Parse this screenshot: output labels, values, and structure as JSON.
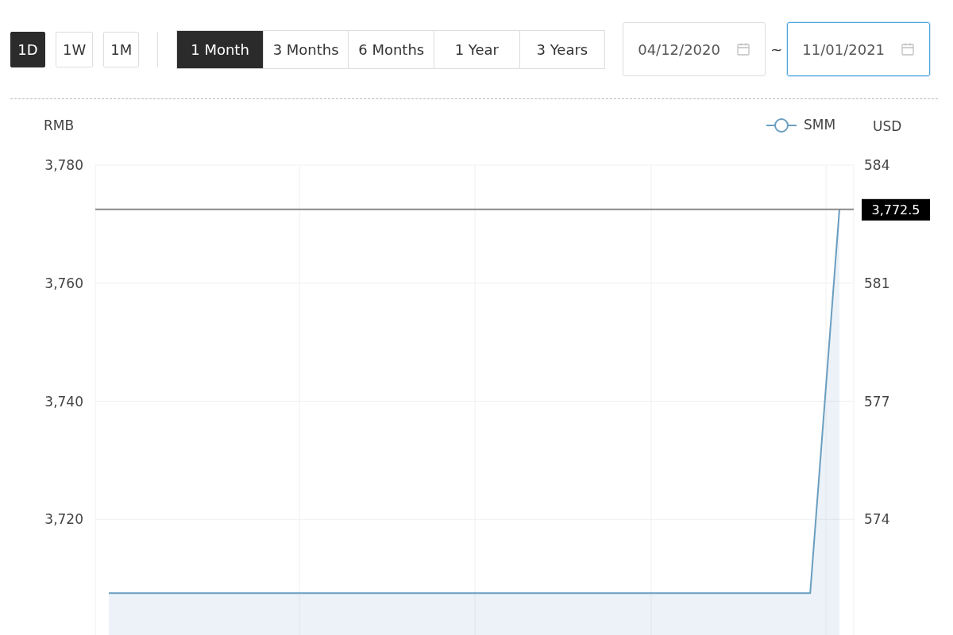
{
  "range_buttons": [
    {
      "label": "1D",
      "selected": true
    },
    {
      "label": "1W",
      "selected": false
    },
    {
      "label": "1M",
      "selected": false
    }
  ],
  "period_tabs": [
    {
      "label": "1 Month",
      "selected": true
    },
    {
      "label": "3 Months",
      "selected": false
    },
    {
      "label": "6 Months",
      "selected": false
    },
    {
      "label": "1 Year",
      "selected": false
    },
    {
      "label": "3 Years",
      "selected": false
    }
  ],
  "date_range": {
    "start": {
      "value": "04/12/2020",
      "focused": false
    },
    "separator": "~",
    "end": {
      "value": "11/01/2021",
      "focused": true
    }
  },
  "chart": {
    "left_unit": "RMB",
    "right_unit": "USD",
    "right_ticks": [
      "584",
      "581",
      "577",
      "574"
    ],
    "chart_data": {
      "type": "area",
      "ylim": [
        3700,
        3780
      ],
      "grid": true,
      "yticks": [
        {
          "value": 3780,
          "label": "3,780"
        },
        {
          "value": 3760,
          "label": "3,760"
        },
        {
          "value": 3740,
          "label": "3,740"
        },
        {
          "value": 3720,
          "label": "3,720"
        }
      ],
      "ref_lines": [
        {
          "axis": "y",
          "value": 3772.5,
          "label": "3,772.5",
          "color": "#8a8a8a"
        }
      ],
      "series": [
        {
          "name": "SMM",
          "color": "#6a9ec0",
          "values": [
            3707.5,
            3707.5,
            3707.5,
            3707.5,
            3707.5,
            3707.5,
            3707.5,
            3707.5,
            3707.5,
            3707.5,
            3707.5,
            3707.5,
            3707.5,
            3707.5,
            3707.5,
            3707.5,
            3707.5,
            3707.5,
            3707.5,
            3707.5,
            3707.5,
            3707.5,
            3707.5,
            3707.5,
            3707.5,
            3772.5
          ]
        }
      ]
    }
  }
}
